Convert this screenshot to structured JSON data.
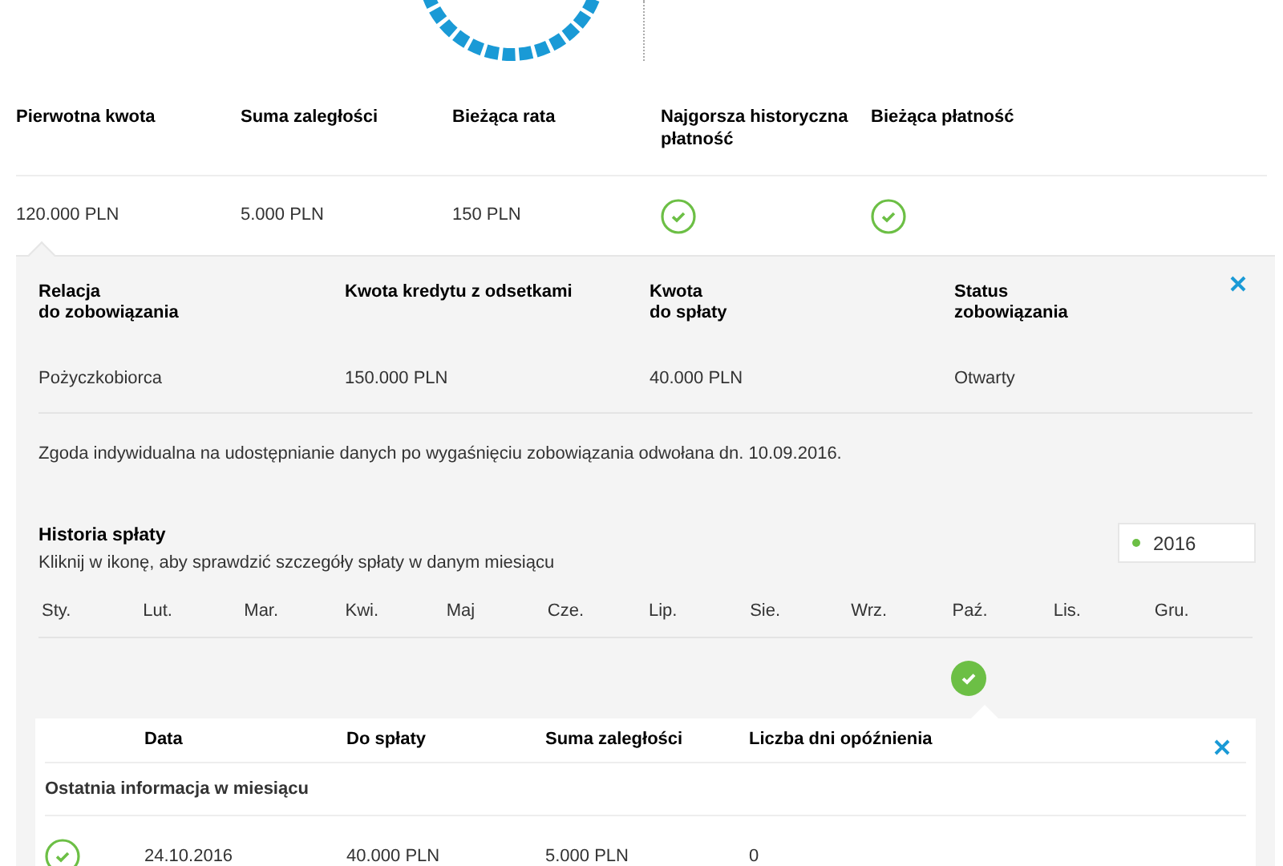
{
  "summary": {
    "columns": [
      "Pierwotna kwota",
      "Suma zaległości",
      "Bieżąca rata",
      "Najgorsza historyczna płatność",
      "Bieżąca płatność"
    ],
    "cells": [
      {
        "kind": "text",
        "text": "120.000 PLN"
      },
      {
        "kind": "text",
        "text": "5.000 PLN"
      },
      {
        "kind": "text",
        "text": "150 PLN"
      },
      {
        "kind": "check",
        "ok": true
      },
      {
        "kind": "check",
        "ok": true
      }
    ]
  },
  "detail": {
    "columns": [
      "Relacja\ndo zobowiązania",
      "Kwota kredytu z odsetkami",
      "Kwota\ndo spłaty",
      "Status\nzobowiązania"
    ],
    "values": [
      "Pożyczkobiorca",
      "150.000 PLN",
      "40.000 PLN",
      "Otwarty"
    ],
    "note": "Zgoda indywidualna na udostępnianie danych po wygaśnięciu zobowiązania odwołana dn. 10.09.2016."
  },
  "history": {
    "title": "Historia spłaty",
    "subtitle": "Kliknij w ikonę, aby sprawdzić szczegóły spłaty w danym miesiącu",
    "year": {
      "value": "2016",
      "color": "#6cbf45"
    },
    "months": [
      {
        "label": "Sty.",
        "paid": false
      },
      {
        "label": "Lut.",
        "paid": false
      },
      {
        "label": "Mar.",
        "paid": false
      },
      {
        "label": "Kwi.",
        "paid": false
      },
      {
        "label": "Maj",
        "paid": false
      },
      {
        "label": "Cze.",
        "paid": false
      },
      {
        "label": "Lip.",
        "paid": false
      },
      {
        "label": "Sie.",
        "paid": false
      },
      {
        "label": "Wrz.",
        "paid": false
      },
      {
        "label": "Paź.",
        "paid": true
      },
      {
        "label": "Lis.",
        "paid": false
      },
      {
        "label": "Gru.",
        "paid": false
      }
    ]
  },
  "month_detail": {
    "columns": [
      "Data",
      "Do spłaty",
      "Suma zaległości",
      "Liczba dni opóźnienia"
    ],
    "section": "Ostatnia informacja w miesiącu",
    "rows": [
      {
        "ok": true,
        "cells": [
          "24.10.2016",
          "40.000 PLN",
          "5.000 PLN",
          "0"
        ]
      }
    ]
  }
}
